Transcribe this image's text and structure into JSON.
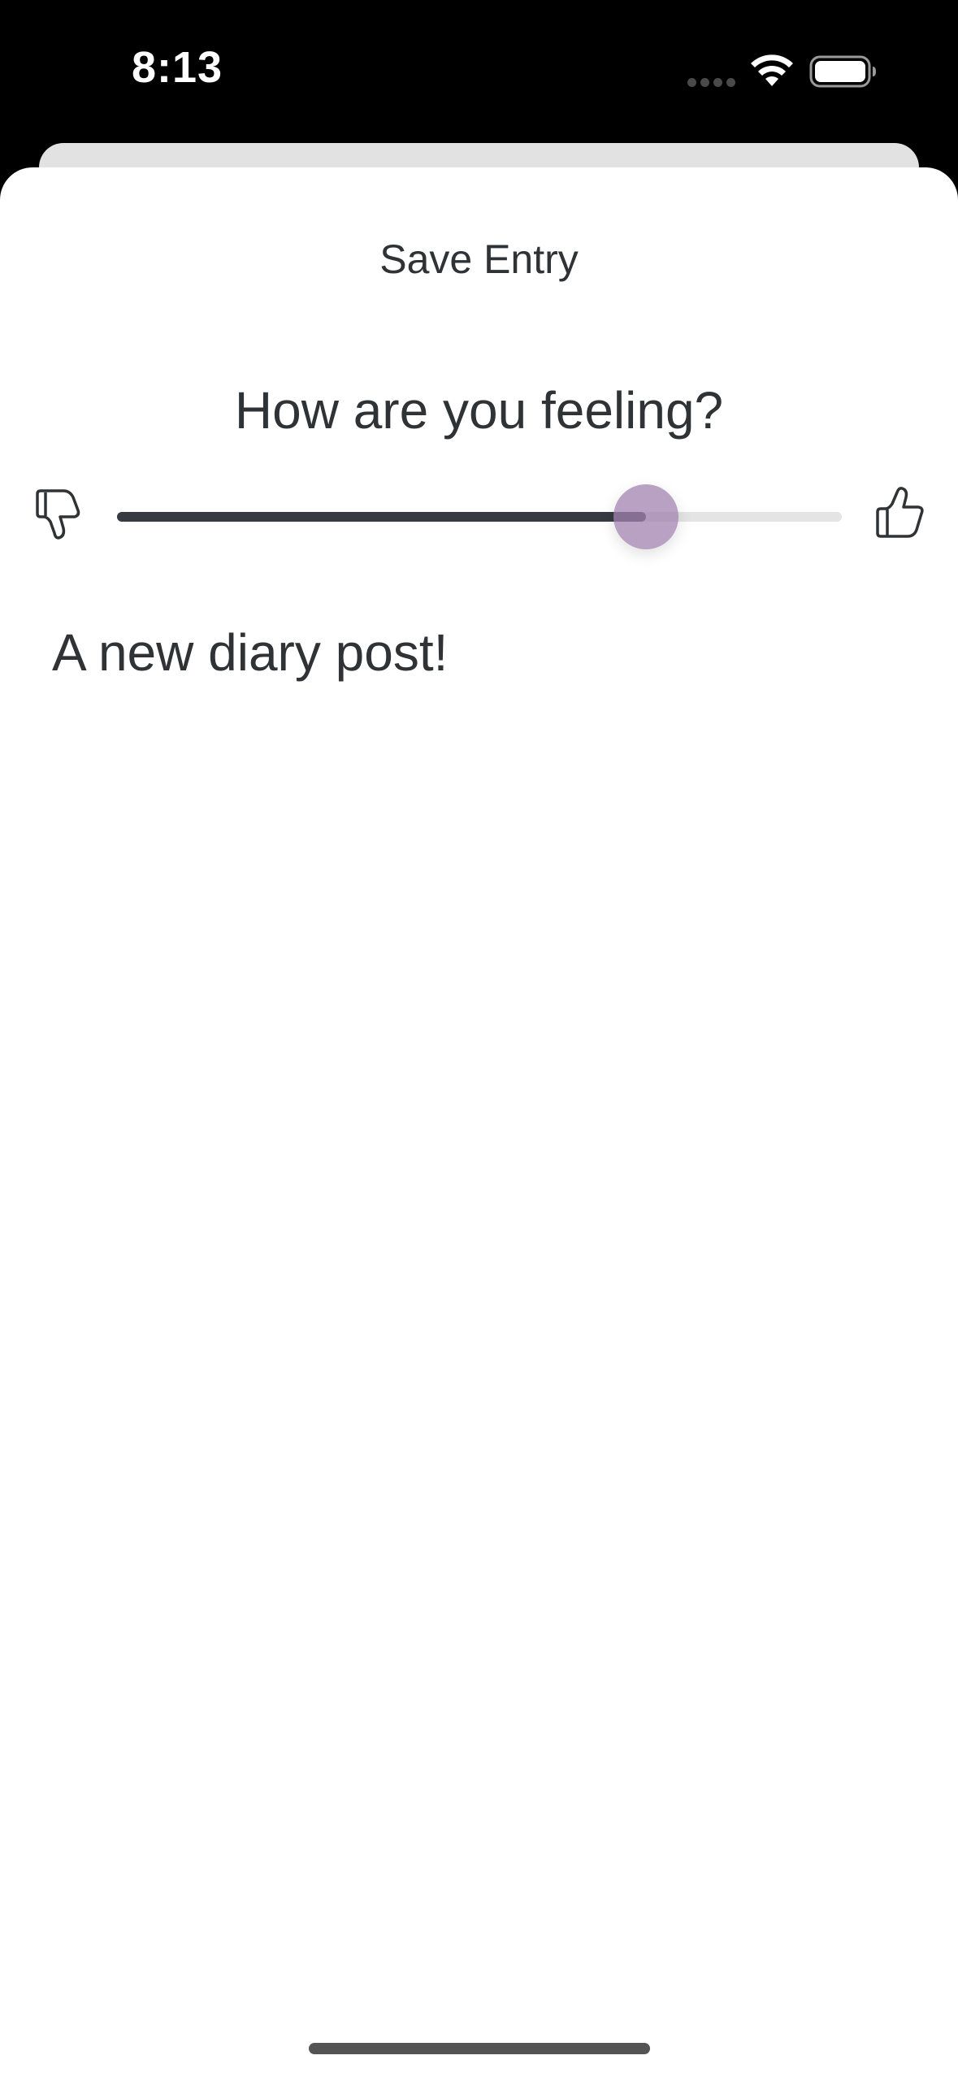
{
  "status_bar": {
    "time": "8:13",
    "icons": [
      "cellular-dots-icon",
      "wifi-icon",
      "battery-icon"
    ]
  },
  "sheet": {
    "title": "Save Entry",
    "question": "How are you feeling?",
    "slider": {
      "value": 0.73,
      "left_icon": "thumbs-down-icon",
      "right_icon": "thumbs-up-icon",
      "fill_color": "#353b40",
      "track_color": "#e4e4e4",
      "thumb_color": "#a082af"
    },
    "entry_text": "A new diary post!"
  }
}
